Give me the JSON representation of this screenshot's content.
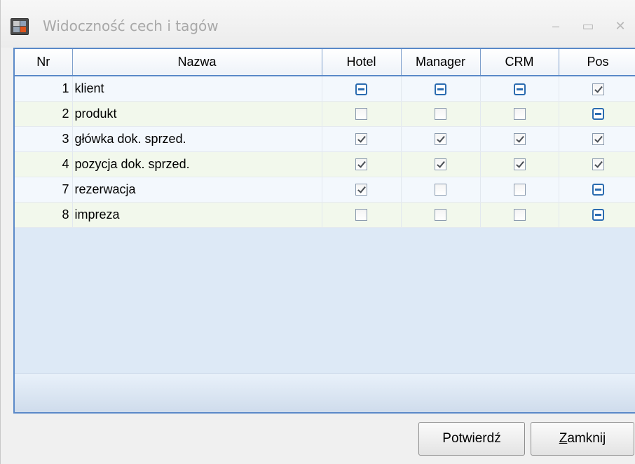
{
  "window": {
    "title": "Widoczność cech i tagów",
    "controls": {
      "minimize": "–",
      "maximize": "▭",
      "close": "✕"
    }
  },
  "grid": {
    "columns": [
      "Nr",
      "Nazwa",
      "Hotel",
      "Manager",
      "CRM",
      "Pos"
    ],
    "rows": [
      {
        "nr": "1",
        "name": "klient",
        "hotel": "indeterminate",
        "manager": "indeterminate",
        "crm": "indeterminate",
        "pos": "checked"
      },
      {
        "nr": "2",
        "name": "produkt",
        "hotel": "unchecked",
        "manager": "unchecked",
        "crm": "unchecked",
        "pos": "indeterminate"
      },
      {
        "nr": "3",
        "name": "główka dok. sprzed.",
        "hotel": "checked",
        "manager": "checked",
        "crm": "checked",
        "pos": "checked"
      },
      {
        "nr": "4",
        "name": "pozycja dok. sprzed.",
        "hotel": "checked",
        "manager": "checked",
        "crm": "checked",
        "pos": "checked"
      },
      {
        "nr": "7",
        "name": "rezerwacja",
        "hotel": "checked",
        "manager": "unchecked",
        "crm": "unchecked",
        "pos": "indeterminate"
      },
      {
        "nr": "8",
        "name": "impreza",
        "hotel": "unchecked",
        "manager": "unchecked",
        "crm": "unchecked",
        "pos": "indeterminate"
      }
    ]
  },
  "buttons": {
    "confirm": "Potwierdź",
    "close_mnemonic": "Z",
    "close_rest": "amknij"
  },
  "colors": {
    "grid_border": "#5a89c8",
    "grid_background": "#dde9f6",
    "indeterminate": "#2b6cb0"
  }
}
